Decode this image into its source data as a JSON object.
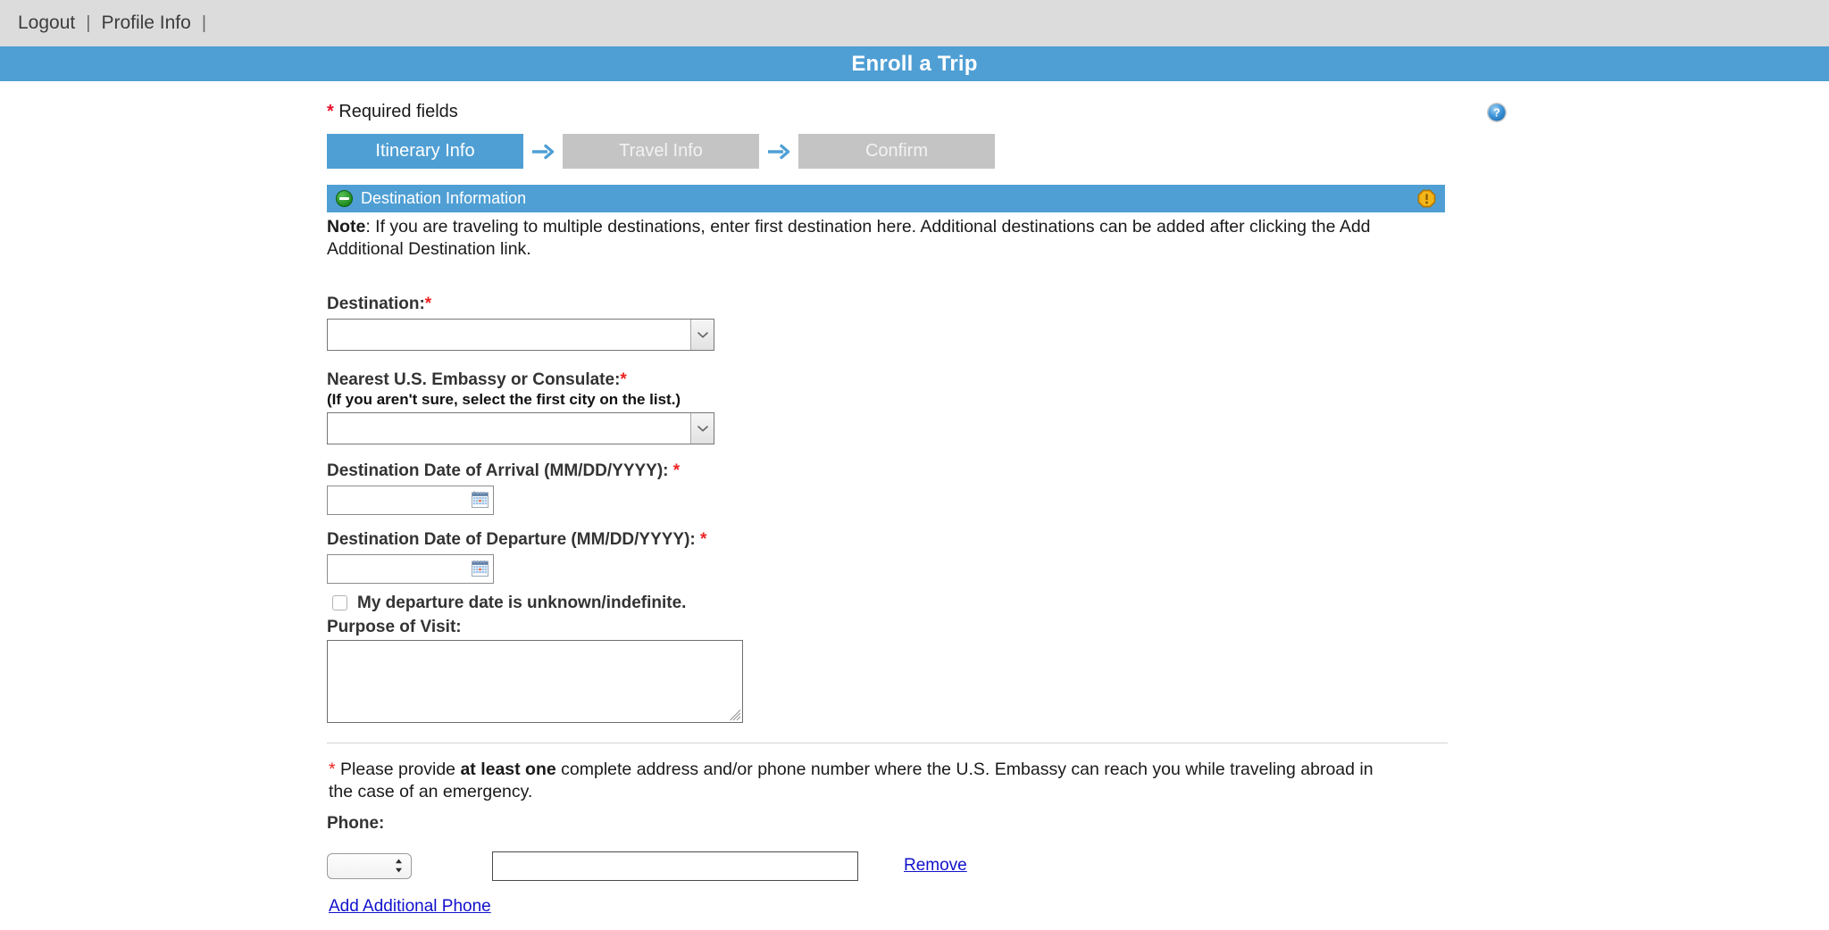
{
  "topbar": {
    "logout_label": "Logout",
    "profile_label": "Profile Info",
    "separator": "|"
  },
  "banner": {
    "title": "Enroll a Trip"
  },
  "help": {
    "icon": "help-question-icon",
    "tooltip": "?"
  },
  "required": {
    "asterisk": "*",
    "text": "Required fields"
  },
  "steps": [
    {
      "label": "Itinerary Info",
      "state": "active"
    },
    {
      "label": "Travel Info",
      "state": "inactive"
    },
    {
      "label": "Confirm",
      "state": "inactive"
    }
  ],
  "step_arrow_icon": "arrow-right-icon",
  "section": {
    "title": "Destination Information",
    "collapse_icon": "minus-circle-icon",
    "warning_icon": "warning-exclamation-icon"
  },
  "note": {
    "label": "Note",
    "text": ": If you are traveling to multiple destinations, enter first destination here. Additional destinations can be added after clicking the Add Additional Destination link."
  },
  "form": {
    "destination": {
      "label": "Destination:",
      "required": "*",
      "value": "",
      "dropdown_icon": "chevron-down-icon"
    },
    "embassy": {
      "label": "Nearest U.S. Embassy or Consulate:",
      "required": "*",
      "hint": "(If you aren't sure, select the first city on the list.)",
      "value": "",
      "dropdown_icon": "chevron-down-icon"
    },
    "arrival": {
      "label": "Destination Date of Arrival (MM/DD/YYYY):",
      "required": "*",
      "value": "",
      "calendar_icon": "calendar-icon"
    },
    "departure": {
      "label": "Destination Date of Departure (MM/DD/YYYY):",
      "required": "*",
      "value": "",
      "calendar_icon": "calendar-icon"
    },
    "departure_unknown": {
      "label": "My departure date is unknown/indefinite.",
      "checked": false
    },
    "purpose": {
      "label": "Purpose of Visit:",
      "value": ""
    }
  },
  "emergency": {
    "asterisk": "*",
    "text_before": " Please provide ",
    "bold": "at least one",
    "text_after": " complete address and/or phone number where the U.S. Embassy can reach you while traveling abroad in the case of an emergency."
  },
  "phone": {
    "label": "Phone:",
    "type_value": "",
    "number_value": "",
    "remove_label": "Remove",
    "add_label": "Add Additional Phone",
    "stepper_icon": "up-down-arrows-icon"
  },
  "colors": {
    "brand_blue": "#4f9fd4",
    "topbar_gray": "#dcdcdc",
    "step_inactive": "#c4c4c4",
    "required_red": "#e8112d",
    "link_blue": "#1111cc",
    "collapse_green": "#1f8a1f",
    "warning_orange": "#f0a500"
  }
}
